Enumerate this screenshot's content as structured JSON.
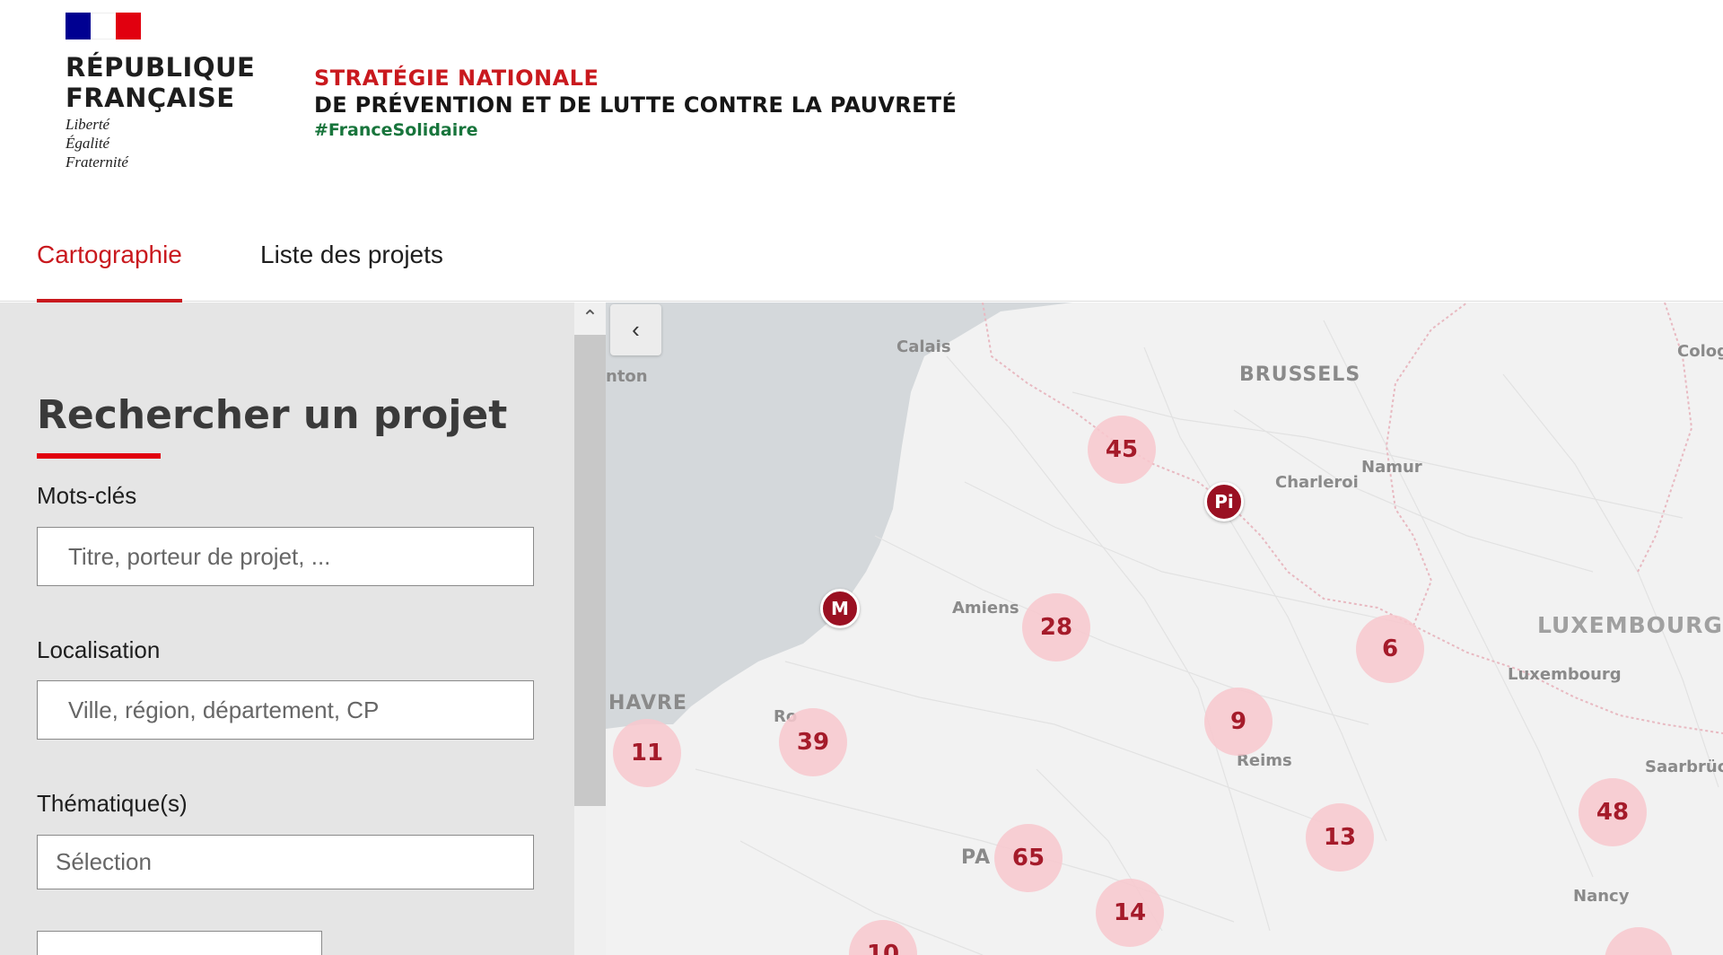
{
  "header": {
    "logo_title_line1": "RÉPUBLIQUE",
    "logo_title_line2": "FRANÇAISE",
    "motto": [
      "Liberté",
      "Égalité",
      "Fraternité"
    ],
    "strategy_line1": "STRATÉGIE NATIONALE",
    "strategy_line2": "DE PRÉVENTION ET DE LUTTE CONTRE LA PAUVRETÉ",
    "hashtag": "#FranceSolidaire"
  },
  "nav": {
    "tabs": [
      {
        "label": "Cartographie",
        "active": true
      },
      {
        "label": "Liste des projets",
        "active": false
      }
    ]
  },
  "sidebar": {
    "title": "Rechercher un projet",
    "keywords_label": "Mots-clés",
    "keywords_placeholder": "Titre, porteur de projet, ...",
    "location_label": "Localisation",
    "location_placeholder": "Ville, région, département, CP",
    "theme_label": "Thématique(s)",
    "theme_placeholder": "Sélection"
  },
  "map": {
    "collapse_icon": "chevron-left-icon",
    "labels": {
      "calais": "Calais",
      "brussels": "BRUSSELS",
      "namur": "Namur",
      "charleroi": "Charleroi",
      "amiens": "Amiens",
      "luxembourg_country": "LUXEMBOURG",
      "luxembourg_city": "Luxembourg",
      "havre": "HAVRE",
      "reims": "Reims",
      "saarbruc": "Saarbrüc",
      "paris": "PA",
      "nancy": "Nancy",
      "colog": "Colog",
      "nton": "nton",
      "rouen": "Ro"
    },
    "clusters": [
      {
        "id": "c45",
        "count": "45"
      },
      {
        "id": "c28",
        "count": "28"
      },
      {
        "id": "c6",
        "count": "6"
      },
      {
        "id": "c9",
        "count": "9"
      },
      {
        "id": "c39",
        "count": "39"
      },
      {
        "id": "c11",
        "count": "11"
      },
      {
        "id": "c13",
        "count": "13"
      },
      {
        "id": "c48",
        "count": "48"
      },
      {
        "id": "c65",
        "count": "65"
      },
      {
        "id": "c14",
        "count": "14"
      },
      {
        "id": "c10",
        "count": "10"
      }
    ],
    "pins": [
      {
        "id": "pin-pi",
        "label": "Pi"
      },
      {
        "id": "pin-m",
        "label": "M"
      }
    ],
    "colors": {
      "cluster_fill": "#f8c8ce",
      "cluster_text": "#a51b2a",
      "pin_fill": "#9a1022",
      "sea": "#d4d8db",
      "land": "#f2f2f2",
      "border": "#e3b3bb"
    }
  },
  "colors": {
    "accent_red": "#c9191e",
    "green": "#18753c",
    "marianne_blue": "#000091",
    "marianne_red": "#e1000f"
  }
}
